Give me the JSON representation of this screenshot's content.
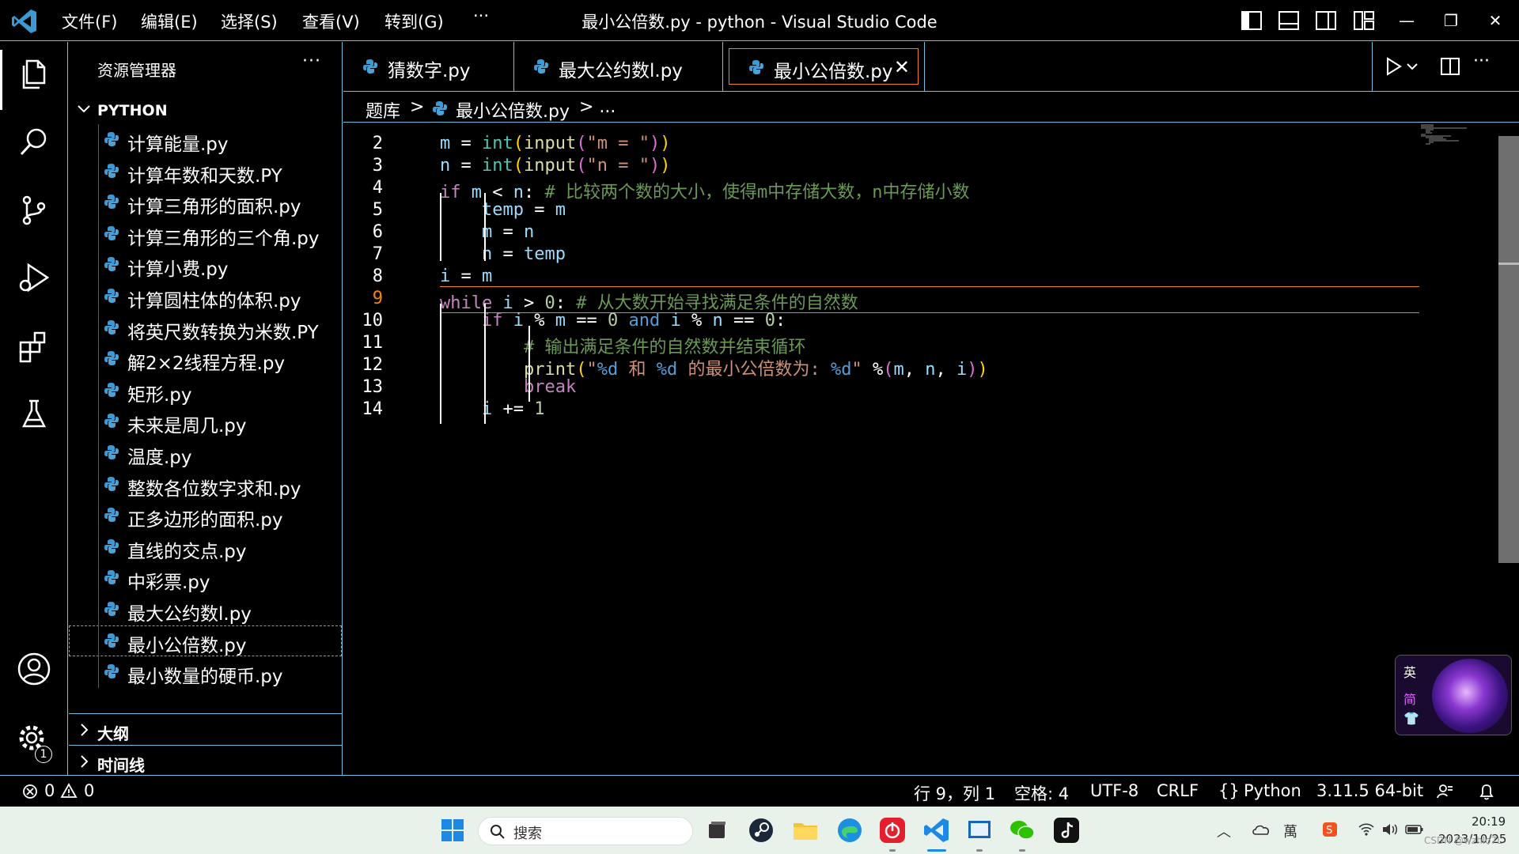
{
  "titlebar": {
    "menu": [
      "文件(F)",
      "编辑(E)",
      "选择(S)",
      "查看(V)",
      "转到(G)",
      "···"
    ],
    "title": "最小公倍数.py - python - Visual Studio Code",
    "window_controls": [
      "minimize",
      "restore",
      "close"
    ]
  },
  "activitybar": {
    "icons": [
      "explorer-icon",
      "search-icon",
      "source-control-icon",
      "run-debug-icon",
      "extensions-icon",
      "testing-icon",
      "account-icon",
      "settings-gear-icon"
    ],
    "settings_badge": "1"
  },
  "sidebar": {
    "title": "资源管理器",
    "more": "···",
    "folder": "PYTHON",
    "files": [
      "计算能量.py",
      "计算年数和天数.PY",
      "计算三角形的面积.py",
      "计算三角形的三个角.py",
      "计算小费.py",
      "计算圆柱体的体积.py",
      "将英尺数转换为米数.PY",
      "解2×2线程方程.py",
      "矩形.py",
      "未来是周几.py",
      "温度.py",
      "整数各位数字求和.py",
      "正多边形的面积.py",
      "直线的交点.py",
      "中彩票.py",
      "最大公约数l.py",
      "最小公倍数.py",
      "最小数量的硬币.py"
    ],
    "active_file_index": 16,
    "sections": [
      "大纲",
      "时间线"
    ]
  },
  "tabs": [
    {
      "label": "猜数字.py",
      "active": false
    },
    {
      "label": "最大公约数l.py",
      "active": false
    },
    {
      "label": "最小公倍数.py",
      "active": true,
      "close": "✕"
    }
  ],
  "breadcrumb": {
    "folder": "题库",
    "sep": ">",
    "file": "最小公倍数.py",
    "tail": "> ..."
  },
  "editor": {
    "current_line": 9,
    "line_numbers": [
      "2",
      "3",
      "4",
      "5",
      "6",
      "7",
      "8",
      "9",
      "10",
      "11",
      "12",
      "13",
      "14"
    ]
  },
  "ime": {
    "lang": "英",
    "mode": "简"
  },
  "statusbar": {
    "errors": "0",
    "warnings": "0",
    "position": "行 9，列 1",
    "spaces": "空格: 4",
    "encoding": "UTF-8",
    "eol": "CRLF",
    "language": "Python",
    "interpreter": "3.11.5 64-bit"
  },
  "taskbar": {
    "search_placeholder": "搜索",
    "time": "20:19",
    "date": "2023/10/25",
    "watermark": "CSDN @wzhlo7L",
    "tray_input": "英"
  }
}
